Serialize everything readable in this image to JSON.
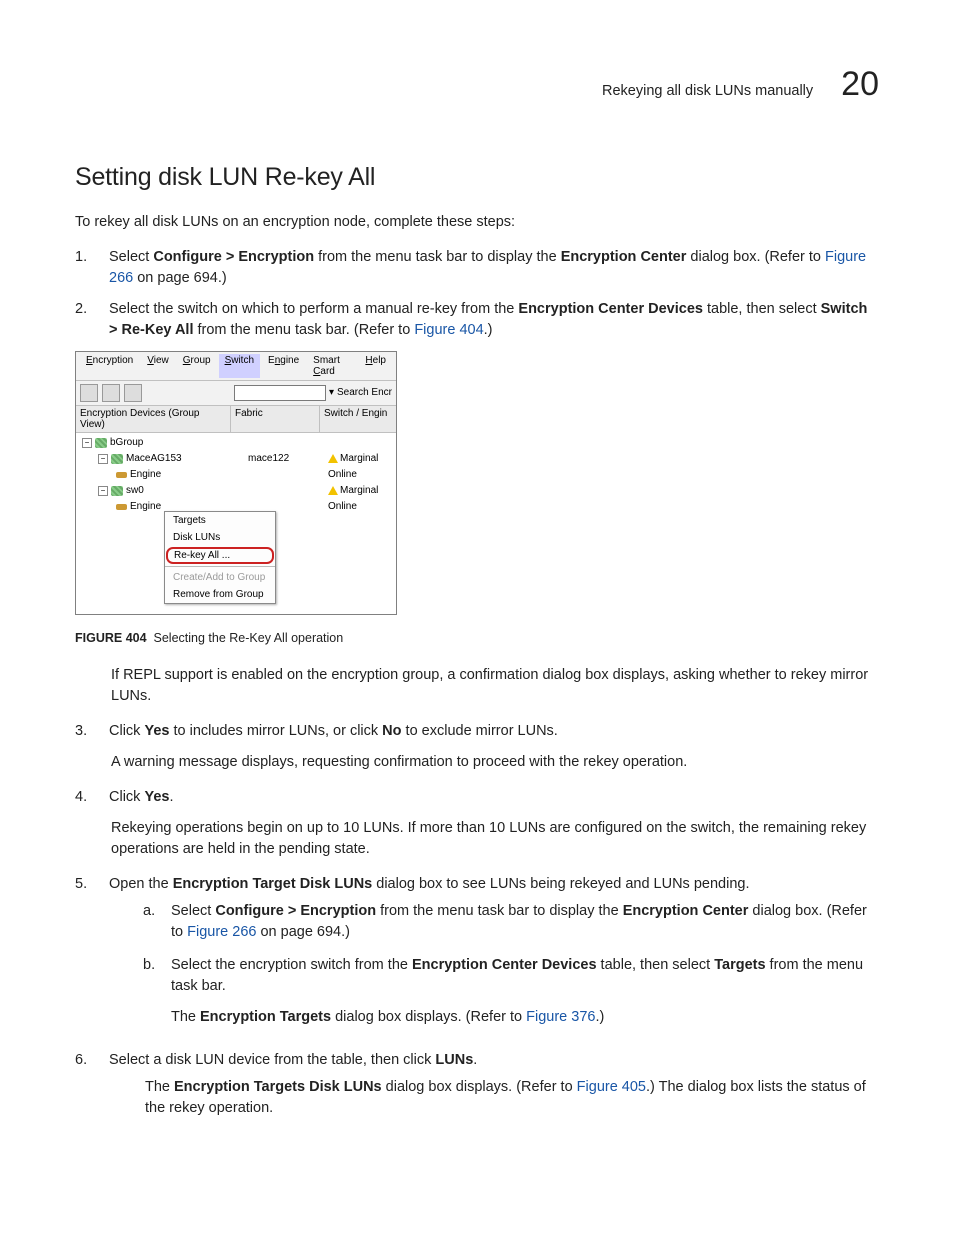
{
  "header": {
    "title": "Rekeying all disk LUNs manually",
    "chapter": "20"
  },
  "h1": "Setting disk LUN Re-key All",
  "intro": "To rekey all disk LUNs on an encryption node, complete these steps:",
  "steps": {
    "1": {
      "pre": "Select ",
      "bold1": "Configure > Encryption",
      "mid1": " from the menu task bar to display the ",
      "bold2": "Encryption Center",
      "mid2": " dialog box. (Refer to ",
      "link": "Figure 266",
      "post": " on page 694.)"
    },
    "2": {
      "pre": "Select the switch on which to perform a manual re-key from the ",
      "bold1": "Encryption Center Devices",
      "mid1": " table, then select ",
      "bold2": "Switch > Re-Key All",
      "mid2": " from the menu task bar. (Refer to ",
      "link": "Figure 404",
      "post": ".)"
    },
    "repl": "If REPL support is enabled on the encryption group, a confirmation dialog box displays, asking whether to rekey mirror LUNs.",
    "3": {
      "pre": "Click ",
      "bold1": "Yes",
      "mid1": " to includes mirror LUNs, or click ",
      "bold2": "No",
      "post": " to exclude mirror LUNs."
    },
    "warn": "A warning message displays, requesting confirmation to proceed with the rekey operation.",
    "4": {
      "pre": "Click ",
      "bold1": "Yes",
      "post": "."
    },
    "rekey": "Rekeying operations begin on up to 10 LUNs. If more than 10 LUNs are configured on the switch, the remaining rekey operations are held in the pending state.",
    "5": {
      "pre": "Open the ",
      "bold1": "Encryption Target Disk LUNs",
      "post": " dialog box to see LUNs being rekeyed and LUNs pending."
    },
    "5a": {
      "pre": "Select ",
      "bold1": "Configure > Encryption",
      "mid1": " from the menu task bar to display the ",
      "bold2": "Encryption Center",
      "mid2": " dialog box. (Refer to ",
      "link": "Figure 266",
      "post": " on page 694.)"
    },
    "5b": {
      "pre": "Select the encryption switch from the ",
      "bold1": "Encryption Center Devices",
      "mid1": " table, then select ",
      "bold2": "Targets",
      "post": " from the menu task bar."
    },
    "5b2": {
      "pre": "The ",
      "bold1": "Encryption Targets",
      "mid1": " dialog box displays. (Refer to ",
      "link": "Figure 376",
      "post": ".)"
    },
    "6": {
      "pre": "Select a disk LUN device from the table, then click ",
      "bold1": "LUNs",
      "post": "."
    },
    "6b": {
      "pre": "The ",
      "bold1": "Encryption Targets Disk LUNs",
      "mid1": " dialog box displays. (Refer to ",
      "link": "Figure 405",
      "post": ".) The dialog box lists the status of the rekey operation."
    }
  },
  "figure": {
    "label": "FIGURE 404",
    "caption": "Selecting the Re-Key All operation"
  },
  "app": {
    "menu": {
      "enc": "Encryption",
      "view": "View",
      "group": "Group",
      "switch": "Switch",
      "engine": "Engine",
      "card": "Smart Card",
      "help": "Help"
    },
    "search": {
      "btn": "Search Encr"
    },
    "cols": {
      "c1": "Encryption Devices (Group View)",
      "c2": "Fabric",
      "c3": "Switch / Engin"
    },
    "tree": {
      "bgroup": "bGroup",
      "mace": "MaceAG153",
      "mace_fab": "mace122",
      "mace_stat": "Marginal",
      "engine": "Engine",
      "online": "Online",
      "sw0": "sw0",
      "sw0_stat": "Marginal"
    },
    "ctx": {
      "targets": "Targets",
      "disk": "Disk LUNs",
      "rekey": "Re-key All ...",
      "create": "Create/Add to Group",
      "remove": "Remove from Group"
    }
  }
}
